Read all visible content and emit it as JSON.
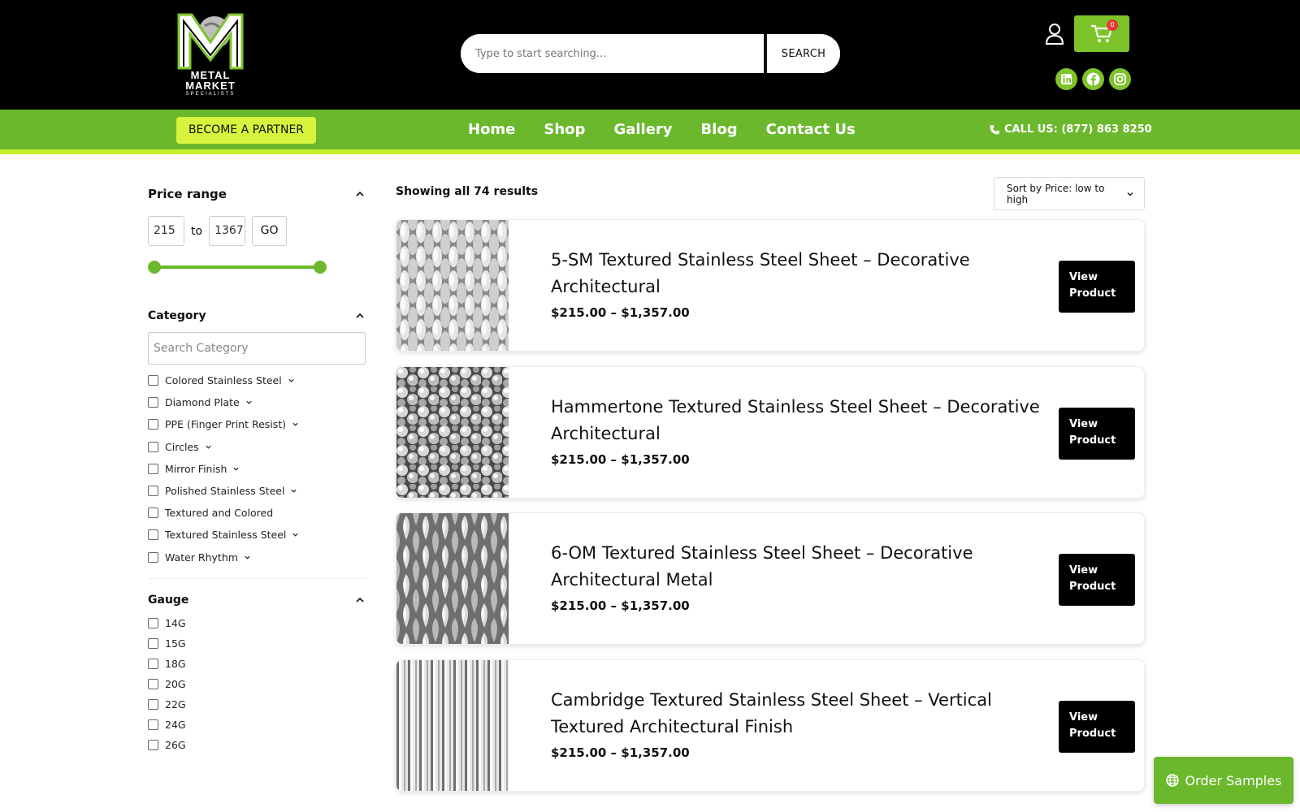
{
  "brand": {
    "logo_text": "METAL MARKET",
    "logo_subtext": "SPECIALISTS"
  },
  "header": {
    "search_placeholder": "Type to start searching...",
    "search_button": "SEARCH",
    "cart_count": "0",
    "icons": [
      "user-icon",
      "cart-icon",
      "linkedin-icon",
      "facebook-icon",
      "instagram-icon"
    ]
  },
  "nav": {
    "partner_button": "BECOME A PARTNER",
    "links": [
      "Home",
      "Shop",
      "Gallery",
      "Blog",
      "Contact Us"
    ],
    "call_label": "CALL US: (877) 863 8250"
  },
  "sidebar": {
    "price_range": {
      "title": "Price range",
      "min_value": "215",
      "to_label": "to",
      "max_value": "1367",
      "go_label": "GO",
      "slider_min_fraction": 0.0,
      "slider_max_fraction": 1.0
    },
    "category": {
      "title": "Category",
      "search_placeholder": "Search Category",
      "items": [
        {
          "label": "Colored Stainless Steel",
          "expandable": true
        },
        {
          "label": "Diamond Plate",
          "expandable": true
        },
        {
          "label": "PPE (Finger Print Resist)",
          "expandable": true
        },
        {
          "label": "Circles",
          "expandable": true
        },
        {
          "label": "Mirror Finish",
          "expandable": true
        },
        {
          "label": "Polished Stainless Steel",
          "expandable": true
        },
        {
          "label": "Textured and Colored",
          "expandable": false
        },
        {
          "label": "Textured Stainless Steel",
          "expandable": true
        },
        {
          "label": "Water Rhythm",
          "expandable": true
        }
      ]
    },
    "gauge": {
      "title": "Gauge",
      "items": [
        "14G",
        "15G",
        "18G",
        "20G",
        "22G",
        "24G",
        "26G"
      ]
    }
  },
  "main": {
    "results_text": "Showing all 74 results",
    "sort_label": "Sort by Price: low to high",
    "view_button_label": "View\nProduct",
    "products": [
      {
        "title": "5-SM Textured Stainless Steel Sheet – Decorative Architectural",
        "price": "$215.00 – $1,357.00",
        "texture": "oval"
      },
      {
        "title": "Hammertone Textured Stainless Steel Sheet – Decorative Architectural",
        "price": "$215.00 – $1,357.00",
        "texture": "hammer"
      },
      {
        "title": "6-OM Textured Stainless Steel Sheet – Decorative Architectural Metal",
        "price": "$215.00 – $1,357.00",
        "texture": "drop"
      },
      {
        "title": "Cambridge Textured Stainless Steel Sheet – Vertical Textured Architectural Finish",
        "price": "$215.00 – $1,357.00",
        "texture": "vertical"
      }
    ]
  },
  "floating": {
    "order_samples_label": "Order Samples"
  },
  "colors": {
    "green": "#6cb82d",
    "lime": "#d7f33d",
    "stripe": "#c8f02a",
    "black": "#000000",
    "badge_red": "#e53935"
  }
}
